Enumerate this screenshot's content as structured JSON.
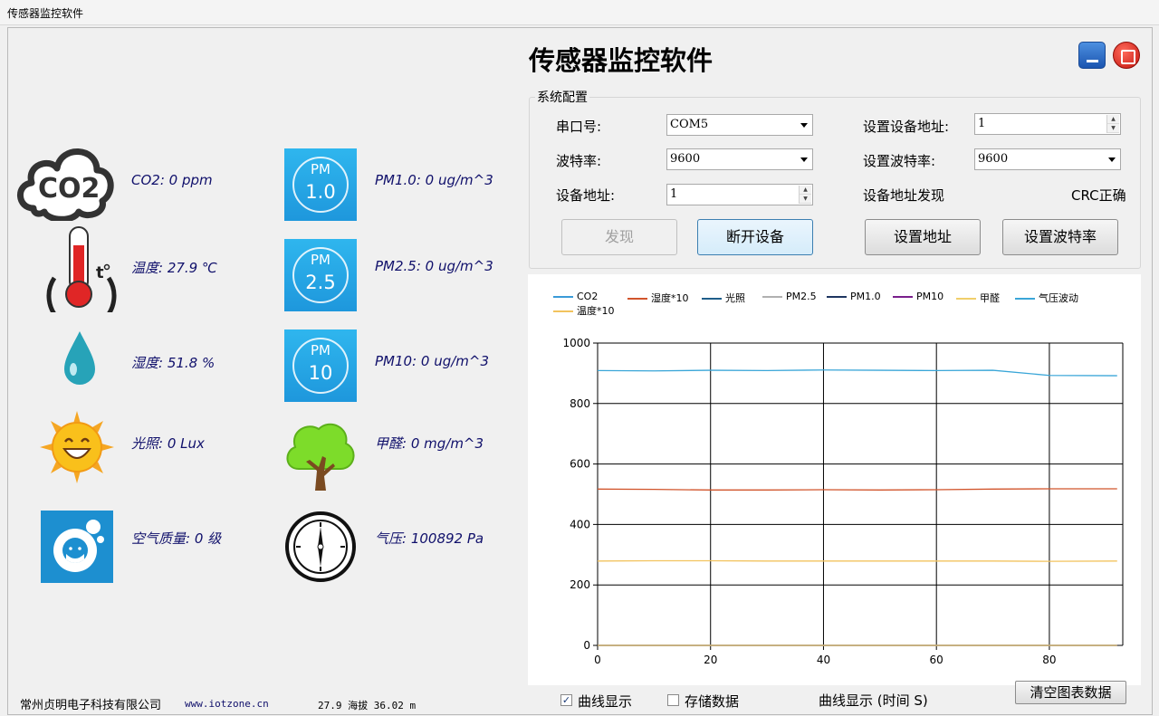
{
  "window": {
    "title": "传感器监控软件",
    "app_title": "传感器监控软件"
  },
  "sensors": {
    "co2": "CO2: 0 ppm",
    "temperature": "温度: 27.9 ℃",
    "humidity": "湿度: 51.8 %",
    "light": "光照: 0 Lux",
    "air_quality": "空气质量: 0 级",
    "pm1": "PM1.0: 0 ug/m^3",
    "pm25": "PM2.5: 0 ug/m^3",
    "pm10": "PM10: 0 ug/m^3",
    "formaldehyde": "甲醛: 0 mg/m^3",
    "pressure": "气压: 100892 Pa"
  },
  "icons": {
    "co2": "CO2",
    "pm1": {
      "top": "PM",
      "value": "1.0"
    },
    "pm25": {
      "top": "PM",
      "value": "2.5"
    },
    "pm10": {
      "top": "PM",
      "value": "10"
    }
  },
  "config": {
    "legend": "系统配置",
    "port_label": "串口号:",
    "port_value": "COM5",
    "baud_label": "波特率:",
    "baud_value": "9600",
    "addr_label": "设备地址:",
    "addr_value": "1",
    "set_addr_label": "设置设备地址:",
    "set_addr_value": "1",
    "set_baud_label": "设置波特率:",
    "set_baud_value": "9600",
    "discover_label": "设备地址发现",
    "crc_status": "CRC正确",
    "btn_discover": "发现",
    "btn_disconnect": "断开设备",
    "btn_set_addr": "设置地址",
    "btn_set_baud": "设置波特率"
  },
  "chart_data": {
    "type": "line",
    "xlim": [
      0,
      93
    ],
    "ylim": [
      0,
      1000
    ],
    "x_ticks": [
      0,
      20,
      40,
      60,
      80
    ],
    "y_ticks": [
      0,
      200,
      400,
      600,
      800,
      1000
    ],
    "grid": true,
    "legend_position": "top-left",
    "legend": [
      "CO2",
      "湿度*10",
      "光照",
      "PM2.5",
      "PM1.0",
      "PM10",
      "甲醛",
      "气压波动",
      "温度*10"
    ],
    "series": [
      {
        "name": "CO2",
        "color": "#3a9bd8",
        "values": [
          0,
          0,
          0,
          0,
          0,
          0,
          0,
          0,
          0,
          0
        ]
      },
      {
        "name": "湿度*10",
        "color": "#d1542b",
        "values": [
          517,
          516,
          514,
          514,
          515,
          514,
          515,
          517,
          518,
          518
        ]
      },
      {
        "name": "光照",
        "color": "#1f5e8a",
        "values": [
          0,
          0,
          0,
          0,
          0,
          0,
          0,
          0,
          0,
          0
        ]
      },
      {
        "name": "PM2.5",
        "color": "#b0b0b0",
        "values": [
          0,
          0,
          0,
          0,
          0,
          0,
          0,
          0,
          0,
          0
        ]
      },
      {
        "name": "PM1.0",
        "color": "#1e3560",
        "values": [
          0,
          0,
          0,
          0,
          0,
          0,
          0,
          0,
          0,
          0
        ]
      },
      {
        "name": "PM10",
        "color": "#7a1f8c",
        "values": [
          0,
          0,
          0,
          0,
          0,
          0,
          0,
          0,
          0,
          0
        ]
      },
      {
        "name": "甲醛",
        "color": "#f0cf6a",
        "values": [
          0,
          0,
          0,
          0,
          0,
          0,
          0,
          0,
          0,
          0
        ]
      },
      {
        "name": "气压波动",
        "color": "#3aa6d8",
        "values": [
          909,
          908,
          910,
          909,
          911,
          910,
          909,
          910,
          893,
          892
        ]
      },
      {
        "name": "温度*10",
        "color": "#f2c35e",
        "values": [
          279,
          280,
          280,
          279,
          279,
          279,
          279,
          279,
          278,
          279
        ]
      }
    ],
    "x": [
      0,
      10,
      20,
      30,
      40,
      50,
      60,
      70,
      80,
      92
    ]
  },
  "footer": {
    "company": "常州贞明电子科技有限公司",
    "website": "www.iotzone.cn",
    "status": "27.9 海拔 36.02 m",
    "chk_curve": "曲线显示",
    "chk_save": "存储数据",
    "curve_time": "曲线显示 (时间 S)",
    "btn_clear": "清空图表数据"
  }
}
